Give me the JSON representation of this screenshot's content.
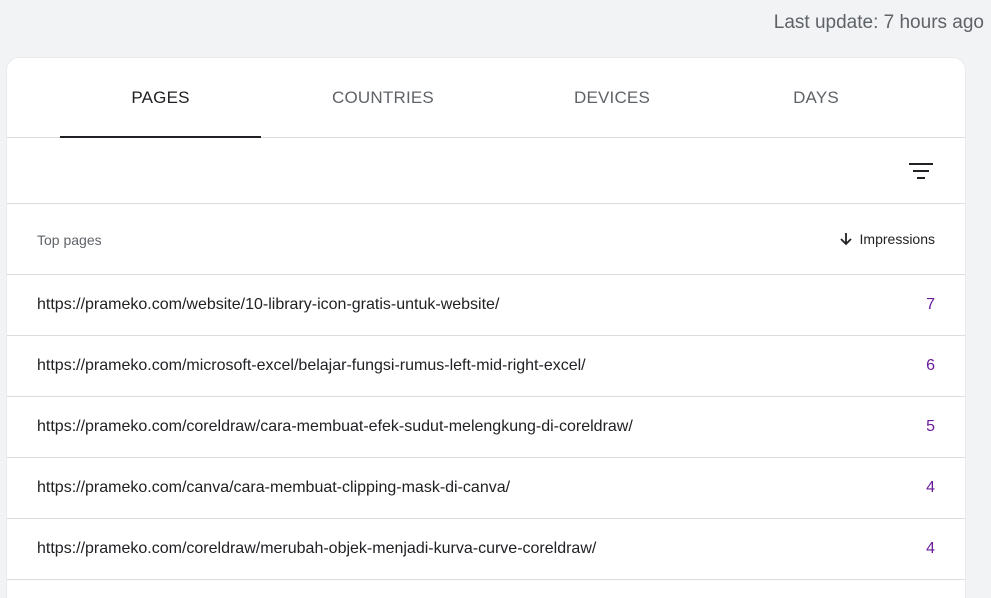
{
  "header": {
    "last_update": "Last update: 7 hours ago"
  },
  "tabs": [
    {
      "label": "PAGES",
      "active": true
    },
    {
      "label": "COUNTRIES",
      "active": false
    },
    {
      "label": "DEVICES",
      "active": false
    },
    {
      "label": "DAYS",
      "active": false
    }
  ],
  "toolbar": {
    "filter_icon": "filter-icon"
  },
  "table": {
    "column_label": "Top pages",
    "sort_column": "Impressions",
    "sort_icon": "arrow-down-icon",
    "rows": [
      {
        "url": "https://prameko.com/website/10-library-icon-gratis-untuk-website/",
        "impressions": "7"
      },
      {
        "url": "https://prameko.com/microsoft-excel/belajar-fungsi-rumus-left-mid-right-excel/",
        "impressions": "6"
      },
      {
        "url": "https://prameko.com/coreldraw/cara-membuat-efek-sudut-melengkung-di-coreldraw/",
        "impressions": "5"
      },
      {
        "url": "https://prameko.com/canva/cara-membuat-clipping-mask-di-canva/",
        "impressions": "4"
      },
      {
        "url": "https://prameko.com/coreldraw/merubah-objek-menjadi-kurva-curve-coreldraw/",
        "impressions": "4"
      }
    ]
  },
  "colors": {
    "value": "#6a1b9a",
    "background": "#f1f3f4"
  }
}
